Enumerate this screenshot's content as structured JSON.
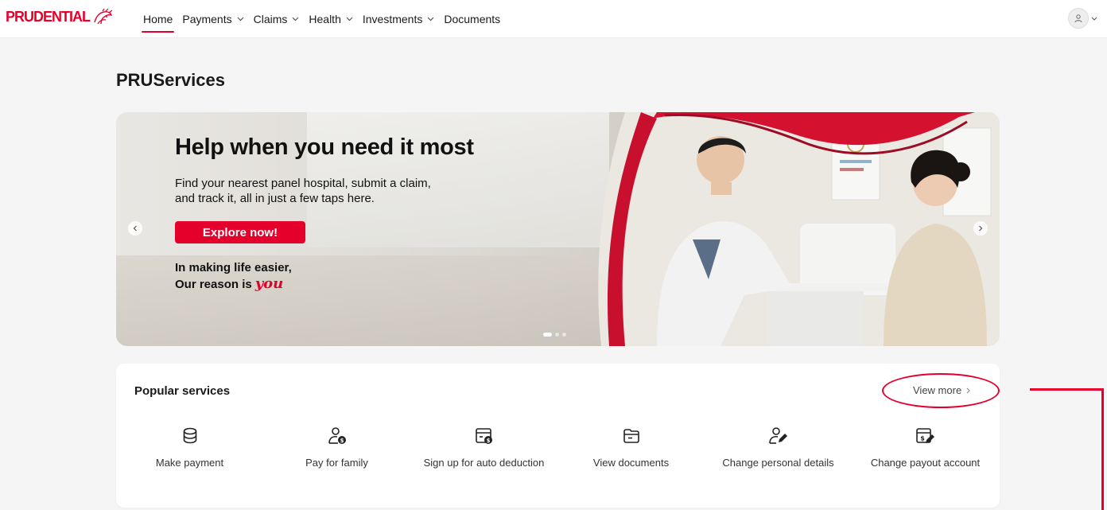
{
  "brand": {
    "logo_text": "PRUDENTIAL",
    "accent": "#e4002b"
  },
  "nav": {
    "items": [
      {
        "label": "Home",
        "active": true,
        "dropdown": false
      },
      {
        "label": "Payments",
        "dropdown": true
      },
      {
        "label": "Claims",
        "dropdown": true
      },
      {
        "label": "Health",
        "dropdown": true
      },
      {
        "label": "Investments",
        "dropdown": true
      },
      {
        "label": "Documents",
        "dropdown": false
      }
    ]
  },
  "page": {
    "title": "PRUServices"
  },
  "banner": {
    "headline": "Help when you need it most",
    "subtext_line1": "Find your nearest panel hospital, submit a claim,",
    "subtext_line2": "and track it, all in just a few taps here.",
    "cta_label": "Explore now!",
    "tagline_line1": "In making life easier,",
    "tagline_line2": "Our reason is",
    "tagline_emphasis": "you",
    "slide_count": 3,
    "active_slide": 1
  },
  "popular_services": {
    "title": "Popular services",
    "view_more_label": "View more",
    "items": [
      {
        "label": "Make payment",
        "icon": "coins-icon"
      },
      {
        "label": "Pay for family",
        "icon": "family-payment-icon"
      },
      {
        "label": "Sign up for auto deduction",
        "icon": "auto-deduction-icon"
      },
      {
        "label": "View documents",
        "icon": "folder-icon"
      },
      {
        "label": "Change personal details",
        "icon": "edit-person-icon"
      },
      {
        "label": "Change payout account",
        "icon": "edit-payout-icon"
      }
    ]
  }
}
